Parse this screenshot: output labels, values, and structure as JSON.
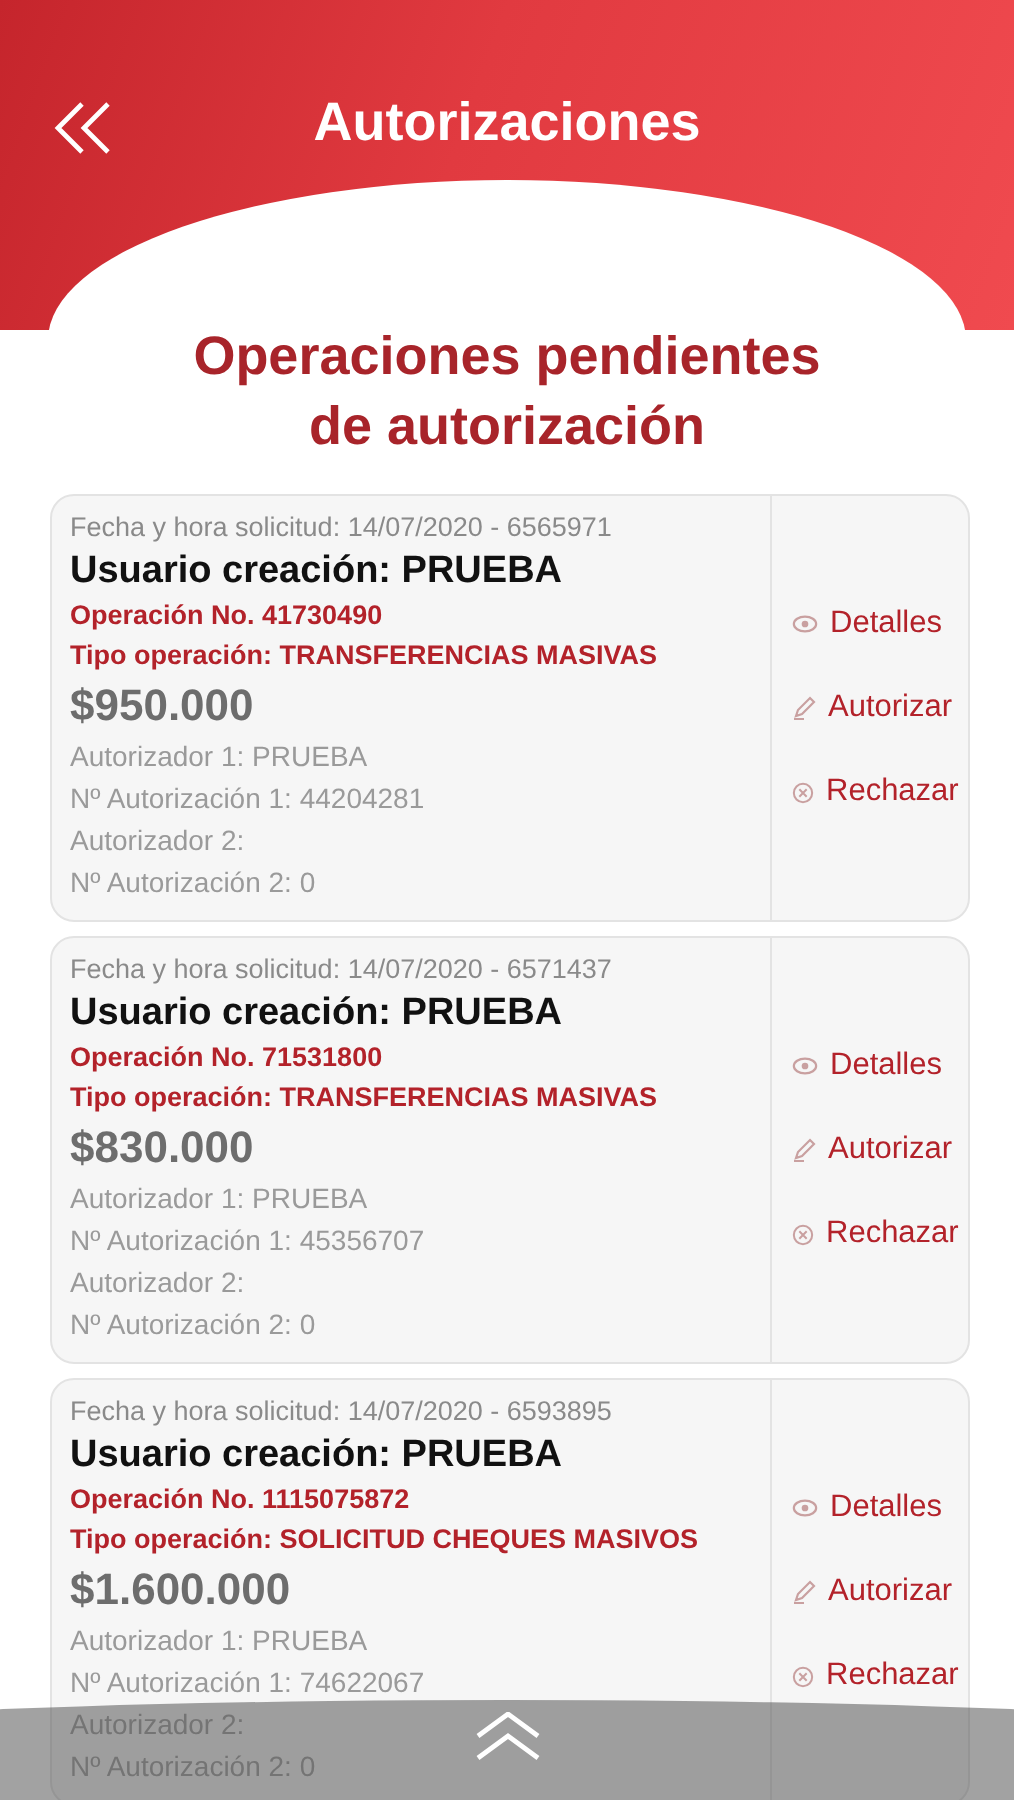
{
  "header": {
    "title": "Autorizaciones"
  },
  "heading": [
    "Operaciones pendientes",
    "de autorización"
  ],
  "operations": [
    {
      "request": "Fecha y hora solicitud: 14/07/2020 - 6565971",
      "user": "Usuario creación: PRUEBA",
      "operation": "Operación No. 41730490",
      "type": "Tipo operación: TRANSFERENCIAS MASIVAS",
      "amount": "$950.000",
      "details": [
        "Autorizador 1: PRUEBA",
        "Nº Autorización 1: 44204281",
        "Autorizador 2:",
        "Nº Autorización 2: 0"
      ],
      "actions": [
        {
          "kind": "view",
          "label": "Detalles"
        },
        {
          "kind": "approve",
          "label": "Autorizar"
        },
        {
          "kind": "reject",
          "label": "Rechazar"
        }
      ]
    },
    {
      "request": "Fecha y hora solicitud: 14/07/2020 - 6571437",
      "user": "Usuario creación: PRUEBA",
      "operation": "Operación No. 71531800",
      "type": "Tipo operación: TRANSFERENCIAS MASIVAS",
      "amount": "$830.000",
      "details": [
        "Autorizador 1: PRUEBA",
        "Nº Autorización 1: 45356707",
        "Autorizador 2:",
        "Nº Autorización 2: 0"
      ],
      "actions": [
        {
          "kind": "view",
          "label": "Detalles"
        },
        {
          "kind": "approve",
          "label": "Autorizar"
        },
        {
          "kind": "reject",
          "label": "Rechazar"
        }
      ]
    },
    {
      "request": "Fecha y hora solicitud: 14/07/2020 - 6593895",
      "user": "Usuario creación: PRUEBA",
      "operation": "Operación No. 1115075872",
      "type": "Tipo operación: SOLICITUD CHEQUES MASIVOS",
      "amount": "$1.600.000",
      "details": [
        "Autorizador 1: PRUEBA",
        "Nº Autorización 1: 74622067",
        "Autorizador 2:",
        "Nº Autorización 2: 0"
      ],
      "actions": [
        {
          "kind": "view",
          "label": "Detalles"
        },
        {
          "kind": "approve",
          "label": "Autorizar"
        },
        {
          "kind": "reject",
          "label": "Rechazar"
        }
      ]
    }
  ]
}
